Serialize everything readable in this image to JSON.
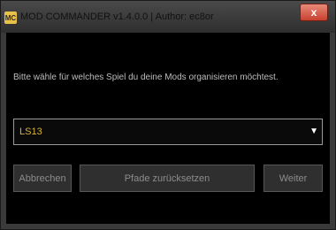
{
  "window": {
    "title": "MOD COMMANDER v1.4.0.0 | Author: ec8or",
    "app_icon_text": "MC",
    "close_glyph": "x"
  },
  "dialog": {
    "prompt": "Bitte wähle für welches Spiel du deine Mods organisieren möchtest.",
    "game_select": {
      "value": "LS13",
      "arrow": "▼"
    }
  },
  "buttons": {
    "cancel": "Abbrechen",
    "reset_paths": "Pfade zurücksetzen",
    "next": "Weiter"
  },
  "colors": {
    "background": "#000000",
    "select_text": "#d8b33a",
    "close_button": "#c7412f"
  }
}
